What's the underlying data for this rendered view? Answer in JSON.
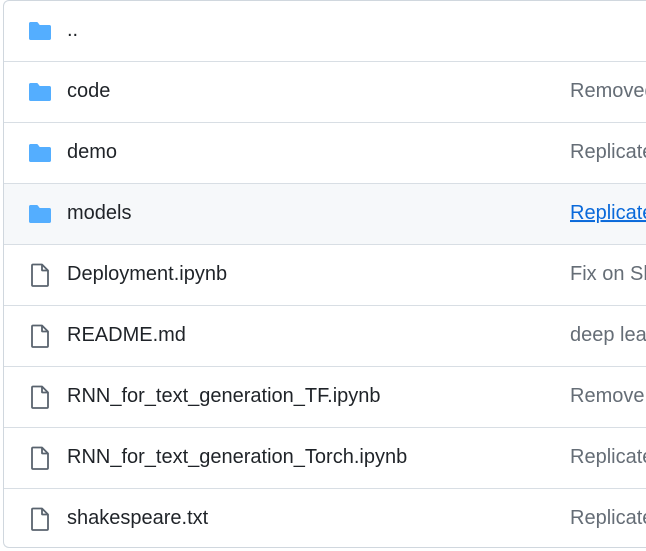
{
  "colors": {
    "folder": "#54aeff",
    "file_icon": "#59636e",
    "link": "#0969da",
    "muted_text": "#656d76",
    "hover_bg": "#f6f8fa",
    "border": "#d0d7de"
  },
  "rows": [
    {
      "name": "..",
      "type": "parent-directory",
      "icon": "folder-icon",
      "commit": ""
    },
    {
      "name": "code",
      "type": "directory",
      "icon": "folder-icon",
      "commit": "Removed"
    },
    {
      "name": "demo",
      "type": "directory",
      "icon": "folder-icon",
      "commit": "Replicate"
    },
    {
      "name": "models",
      "type": "directory",
      "icon": "folder-icon",
      "commit": "Replicate",
      "commit_is_link": true,
      "hovered": true
    },
    {
      "name": "Deployment.ipynb",
      "type": "file",
      "icon": "file-icon",
      "commit": "Fix on Sh"
    },
    {
      "name": "README.md",
      "type": "file",
      "icon": "file-icon",
      "commit": "deep lea"
    },
    {
      "name": "RNN_for_text_generation_TF.ipynb",
      "type": "file",
      "icon": "file-icon",
      "commit": "Remove"
    },
    {
      "name": "RNN_for_text_generation_Torch.ipynb",
      "type": "file",
      "icon": "file-icon",
      "commit": "Replicate"
    },
    {
      "name": "shakespeare.txt",
      "type": "file",
      "icon": "file-icon",
      "commit": "Replicate"
    }
  ]
}
